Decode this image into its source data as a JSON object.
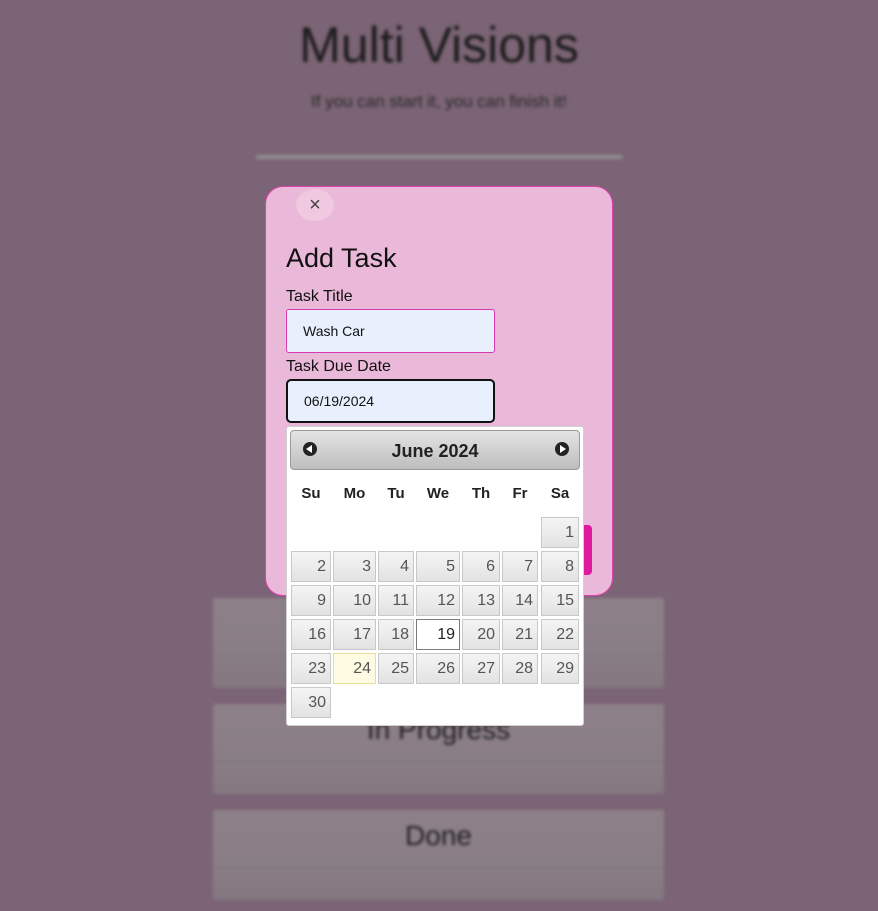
{
  "page": {
    "title": "Multi Visions",
    "tagline": "If you can start it, you can finish it!"
  },
  "columns": [
    {
      "label": ""
    },
    {
      "label": "In Progress"
    },
    {
      "label": "Done"
    }
  ],
  "modal": {
    "close_label": "×",
    "title": "Add Task",
    "task_title_label": "Task Title",
    "task_title_value": "Wash Car",
    "due_date_label": "Task Due Date",
    "due_date_value": "06/19/2024"
  },
  "datepicker": {
    "month_label": "June 2024",
    "prev_icon": "prev-circle-icon",
    "next_icon": "next-circle-icon",
    "weekdays": [
      "Su",
      "Mo",
      "Tu",
      "We",
      "Th",
      "Fr",
      "Sa"
    ],
    "first_weekday_index": 6,
    "days": [
      "1",
      "2",
      "3",
      "4",
      "5",
      "6",
      "7",
      "8",
      "9",
      "10",
      "11",
      "12",
      "13",
      "14",
      "15",
      "16",
      "17",
      "18",
      "19",
      "20",
      "21",
      "22",
      "23",
      "24",
      "25",
      "26",
      "27",
      "28",
      "29",
      "30"
    ],
    "selected_day": "19",
    "today_day": "24"
  },
  "colors": {
    "overlay": "#7b6475",
    "modal_bg": "#eab8d8",
    "modal_border": "#e040b0",
    "accent": "#e01aa0",
    "input_bg": "#e8f0fe"
  }
}
